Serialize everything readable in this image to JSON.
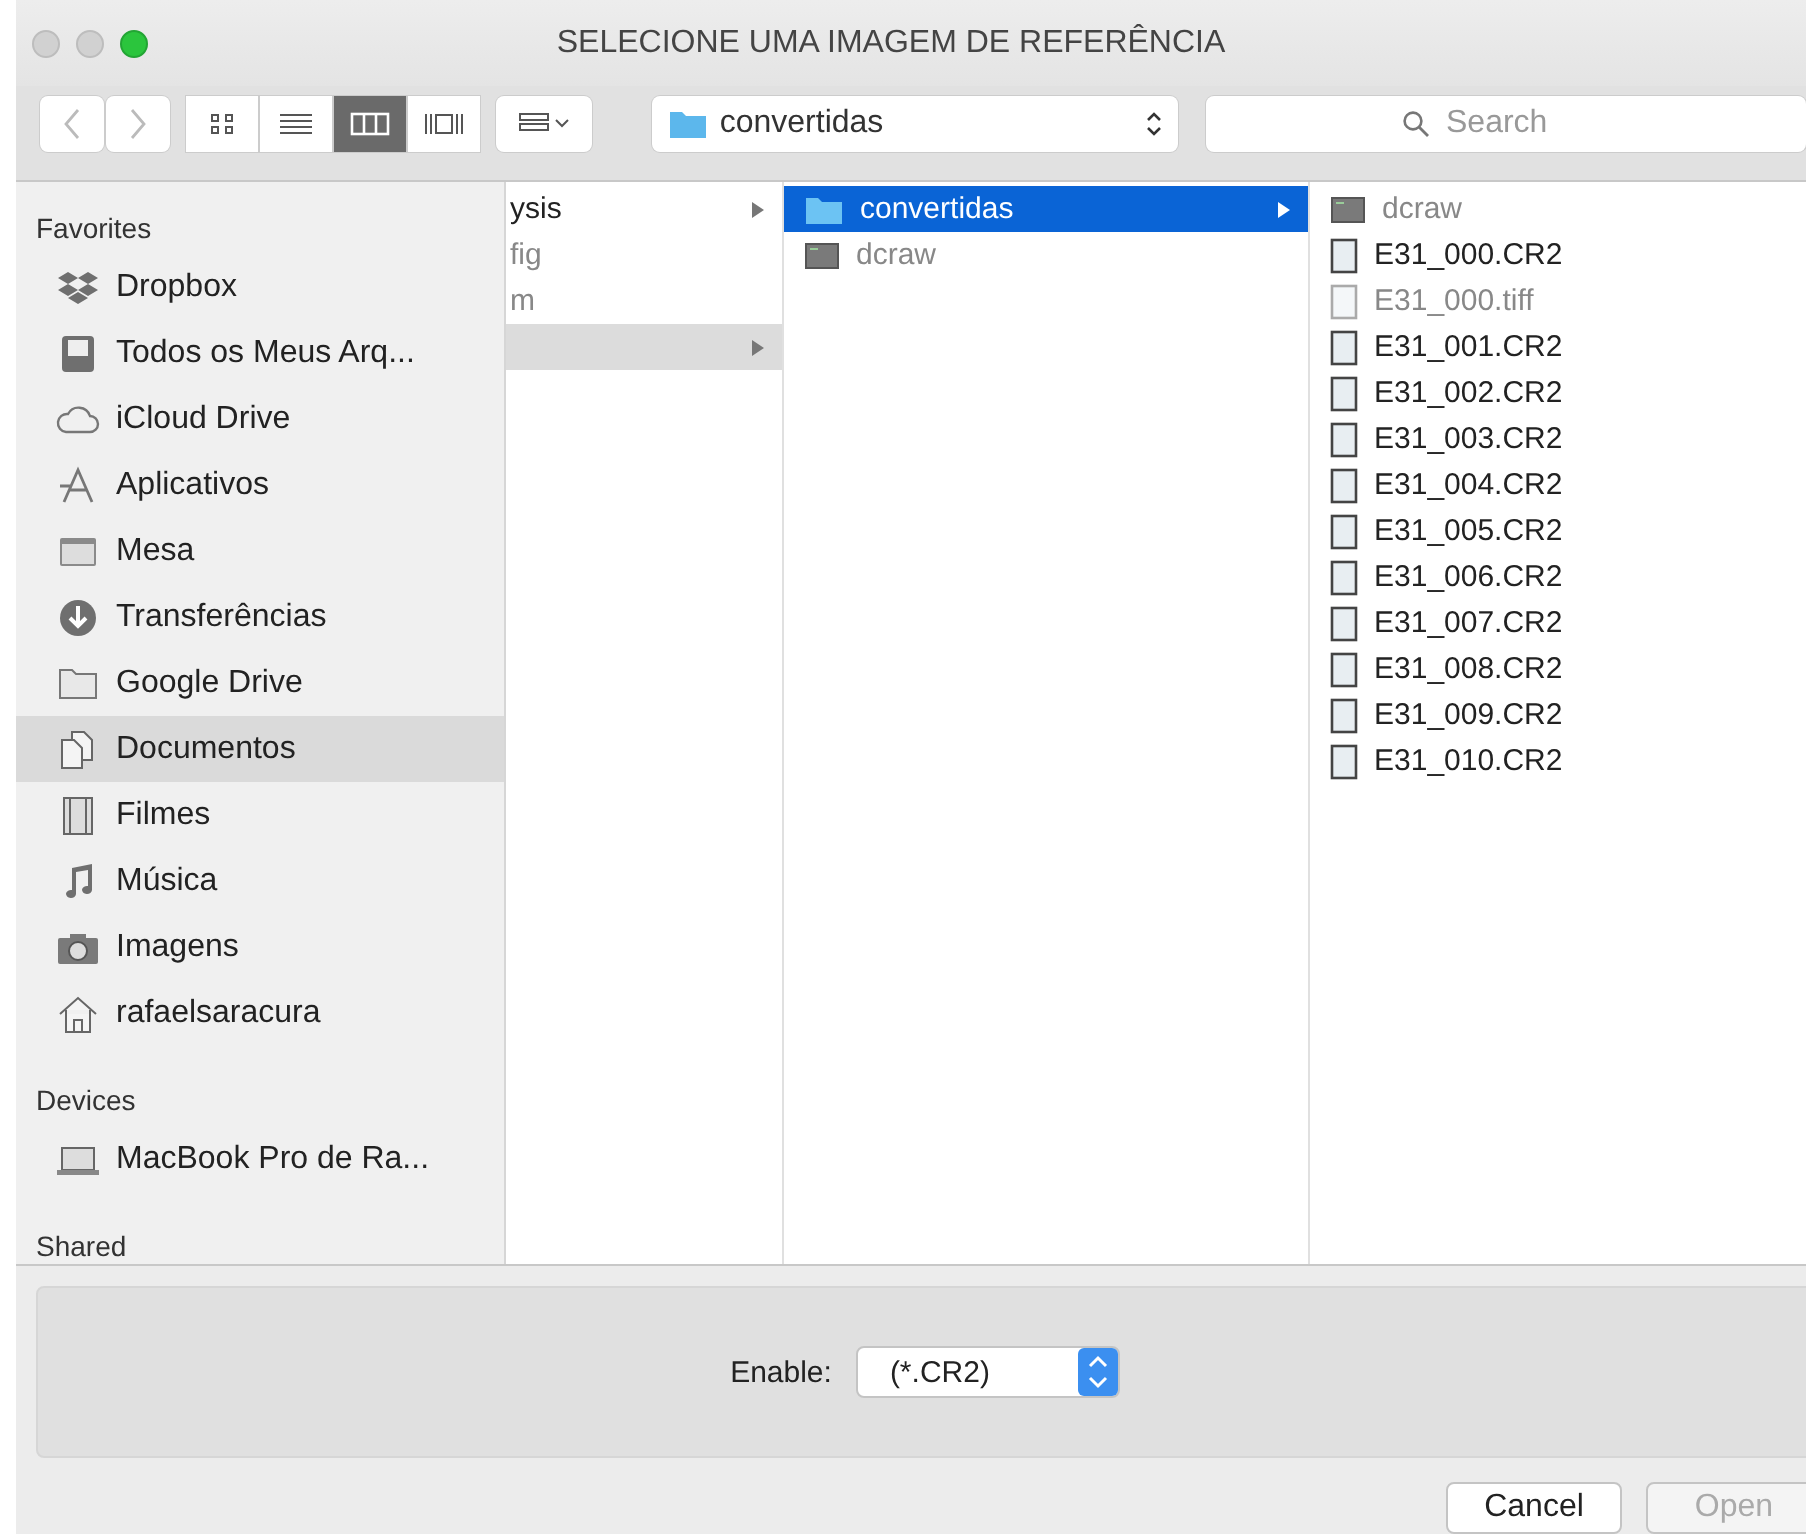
{
  "window": {
    "title": "SELECIONE UMA IMAGEM DE REFERÊNCIA"
  },
  "toolbar": {
    "nav": [
      {
        "kind": "back",
        "disabled": true
      },
      {
        "kind": "forward",
        "disabled": true
      }
    ],
    "view_modes": [
      {
        "kind": "icons",
        "selected": false
      },
      {
        "kind": "list",
        "selected": false
      },
      {
        "kind": "columns",
        "selected": true
      },
      {
        "kind": "coverflow",
        "selected": false
      }
    ],
    "path_popup": "convertidas",
    "search": {
      "placeholder": "Search"
    }
  },
  "sidebar": [
    {
      "title": "Favorites",
      "items": [
        {
          "label": "Dropbox",
          "selected": false
        },
        {
          "label": "Todos os Meus Arq...",
          "selected": false
        },
        {
          "label": "iCloud Drive",
          "selected": false
        },
        {
          "label": "Aplicativos",
          "selected": false
        },
        {
          "label": "Mesa",
          "selected": false
        },
        {
          "label": "Transferências",
          "selected": false
        },
        {
          "label": "Google Drive",
          "selected": false
        },
        {
          "label": "Documentos",
          "selected": true
        },
        {
          "label": "Filmes",
          "selected": false
        },
        {
          "label": "Música",
          "selected": false
        },
        {
          "label": "Imagens",
          "selected": false
        },
        {
          "label": "rafaelsaracura",
          "selected": false
        }
      ]
    },
    {
      "title": "Devices",
      "items": [
        {
          "label": "MacBook Pro de Ra...",
          "selected": false
        }
      ]
    },
    {
      "title": "Shared"
    }
  ],
  "columns": [
    {
      "active": false,
      "rows": [
        {
          "label": "ysis",
          "kind": "none",
          "arrow": true,
          "selected": false,
          "dimmed": false
        },
        {
          "label": "fig",
          "kind": "none",
          "arrow": false,
          "selected": false,
          "dimmed": true
        },
        {
          "label": "m",
          "kind": "none",
          "arrow": false,
          "selected": false,
          "dimmed": true
        },
        {
          "kind": "none",
          "arrow": true,
          "selected": true,
          "dimmed": false
        }
      ]
    },
    {
      "active": true,
      "rows": [
        {
          "label": "convertidas",
          "kind": "folder",
          "arrow": true,
          "selected": true,
          "dimmed": false
        },
        {
          "label": "dcraw",
          "kind": "exec",
          "arrow": false,
          "selected": false,
          "dimmed": true
        }
      ]
    },
    {
      "active": false,
      "rows": [
        {
          "label": "dcraw",
          "kind": "exec",
          "arrow": false,
          "selected": false,
          "dimmed": true
        },
        {
          "label": "E31_000.CR2",
          "kind": "file",
          "arrow": false,
          "selected": false,
          "dimmed": false
        },
        {
          "label": "E31_000.tiff",
          "kind": "file",
          "arrow": false,
          "selected": false,
          "dimmed": true
        },
        {
          "label": "E31_001.CR2",
          "kind": "file",
          "arrow": false,
          "selected": false,
          "dimmed": false
        },
        {
          "label": "E31_002.CR2",
          "kind": "file",
          "arrow": false,
          "selected": false,
          "dimmed": false
        },
        {
          "label": "E31_003.CR2",
          "kind": "file",
          "arrow": false,
          "selected": false,
          "dimmed": false
        },
        {
          "label": "E31_004.CR2",
          "kind": "file",
          "arrow": false,
          "selected": false,
          "dimmed": false
        },
        {
          "label": "E31_005.CR2",
          "kind": "file",
          "arrow": false,
          "selected": false,
          "dimmed": false
        },
        {
          "label": "E31_006.CR2",
          "kind": "file",
          "arrow": false,
          "selected": false,
          "dimmed": false
        },
        {
          "label": "E31_007.CR2",
          "kind": "file",
          "arrow": false,
          "selected": false,
          "dimmed": false
        },
        {
          "label": "E31_008.CR2",
          "kind": "file",
          "arrow": false,
          "selected": false,
          "dimmed": false
        },
        {
          "label": "E31_009.CR2",
          "kind": "file",
          "arrow": false,
          "selected": false,
          "dimmed": false
        },
        {
          "label": "E31_010.CR2",
          "kind": "file",
          "arrow": false,
          "selected": false,
          "dimmed": false
        }
      ]
    }
  ],
  "footer": {
    "label": "Enable:",
    "popup": "(*.CR2)"
  },
  "buttons": [
    {
      "label": "Cancel",
      "disabled": false
    },
    {
      "label": "Open",
      "disabled": true
    }
  ]
}
